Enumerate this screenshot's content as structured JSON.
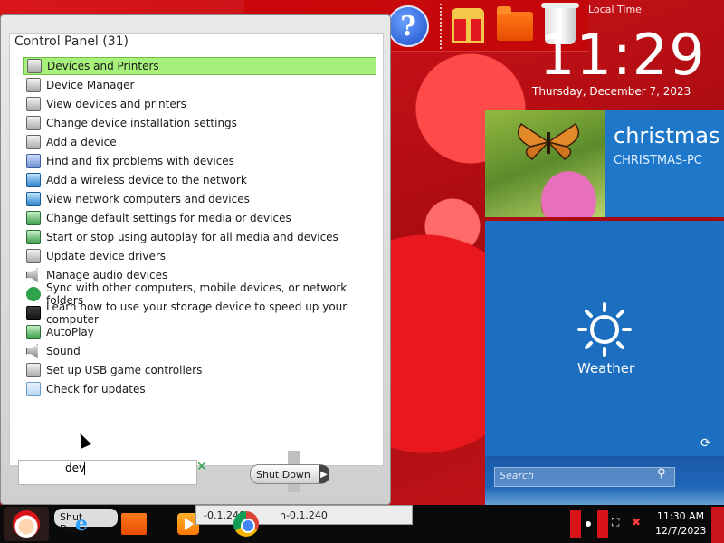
{
  "clock": {
    "label": "Local Time",
    "time": "11:29",
    "date": "Thursday, December 7, 2023"
  },
  "user_tile": {
    "name": "christmas",
    "computer": "CHRISTMAS-PC"
  },
  "weather_tile": {
    "label": "Weather"
  },
  "search_tile": {
    "placeholder": "Search"
  },
  "dock": {
    "icons": [
      "help-icon",
      "gift-icon",
      "folder-icon",
      "trash-icon"
    ]
  },
  "start_menu": {
    "results_header": "Control Panel (31)",
    "items": [
      {
        "label": "Devices and Printers",
        "icon": "printer-icon",
        "selected": true
      },
      {
        "label": "Device Manager",
        "icon": "printer-icon"
      },
      {
        "label": "View devices and printers",
        "icon": "printer-icon"
      },
      {
        "label": "Change device installation settings",
        "icon": "printer-icon"
      },
      {
        "label": "Add a device",
        "icon": "printer-icon"
      },
      {
        "label": "Find and fix problems with devices",
        "icon": "device-icon"
      },
      {
        "label": "Add a wireless device to the network",
        "icon": "network-icon"
      },
      {
        "label": "View network computers and devices",
        "icon": "network-icon"
      },
      {
        "label": "Change default settings for media or devices",
        "icon": "media-icon"
      },
      {
        "label": "Start or stop using autoplay for all media and devices",
        "icon": "media-icon"
      },
      {
        "label": "Update device drivers",
        "icon": "printer-icon"
      },
      {
        "label": "Manage audio devices",
        "icon": "sound-icon"
      },
      {
        "label": "Sync with other computers, mobile devices, or network folders",
        "icon": "sync-icon"
      },
      {
        "label": "Learn how to use your storage device to speed up your computer",
        "icon": "storage-icon"
      },
      {
        "label": "AutoPlay",
        "icon": "media-icon"
      },
      {
        "label": "Sound",
        "icon": "sound-icon"
      },
      {
        "label": "Set up USB game controllers",
        "icon": "printer-icon"
      },
      {
        "label": "Check for updates",
        "icon": "update-icon"
      }
    ],
    "search_value": "dev",
    "shutdown_label": "Shut Down"
  },
  "taskbar": {
    "window_label_1": "-0.1.240",
    "window_label_2": "n-0.1.240",
    "ghost_label": "Shut Down",
    "time": "11:30 AM",
    "date": "12/7/2023"
  },
  "colors": {
    "accent_tile": "#1f77c9",
    "selection": "#a6f07b",
    "wallpaper": "#d9161c"
  }
}
